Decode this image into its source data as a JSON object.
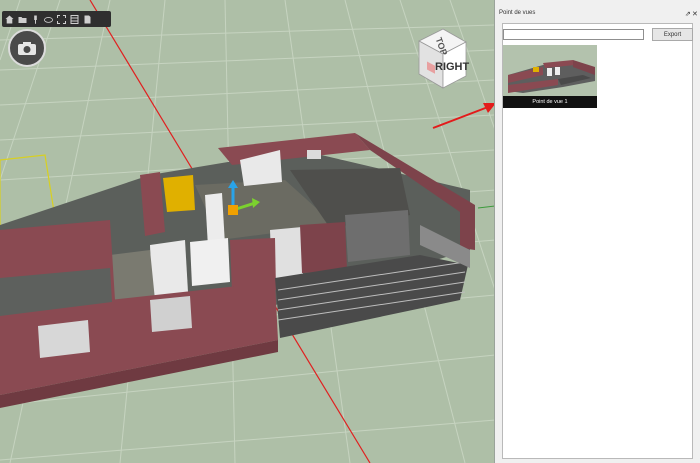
{
  "toolbar": {
    "icons": [
      "home-icon",
      "open-folder-icon",
      "pin-icon",
      "cloud-icon",
      "fit-icon",
      "fullscreen-icon",
      "page-icon"
    ]
  },
  "view_cube": {
    "top_label": "TOP",
    "right_label": "RIGHT"
  },
  "panel": {
    "title": "Point de vues",
    "search_placeholder": "",
    "export_label": "Export",
    "viewpoints": [
      {
        "label": "Point de vue 1"
      }
    ]
  },
  "colors": {
    "grid_floor": "#aebfa7",
    "wall": "#8a4a52",
    "axis_red": "#e02020",
    "annotation_arrow": "#e31b1b"
  }
}
